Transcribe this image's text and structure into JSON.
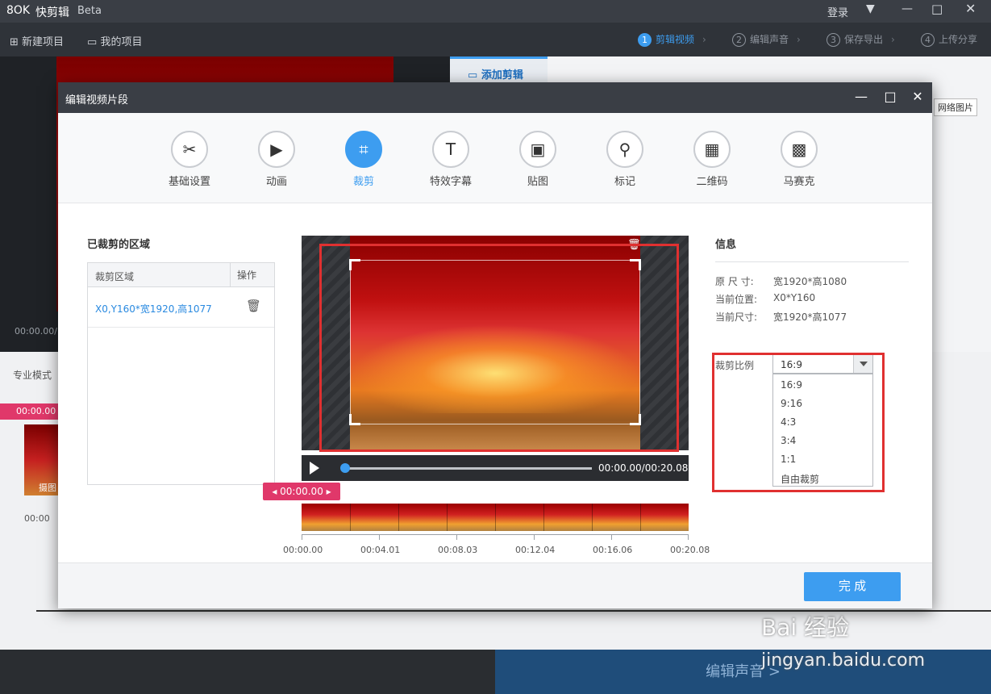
{
  "app": {
    "logo": "8OK",
    "name": "快剪辑",
    "beta": "Beta",
    "login": "登录"
  },
  "toolbar": {
    "new_project": "新建项目",
    "my_projects": "我的项目",
    "steps": [
      {
        "num": "1",
        "label": "剪辑视频"
      },
      {
        "num": "2",
        "label": "编辑声音"
      },
      {
        "num": "3",
        "label": "保存导出"
      },
      {
        "num": "4",
        "label": "上传分享"
      }
    ]
  },
  "background": {
    "add_clip_tab": "添加剪辑",
    "network_image": "网络图片",
    "time_partial": "00:00.00/",
    "pro_mode": "专业模式",
    "marker_time": "00:00.00",
    "clip_label": "摄图",
    "zero_time": "00:00",
    "next_step": "编辑声音 >",
    "watermark": "Bai 经验",
    "watermark_url": "jingyan.baidu.com"
  },
  "dialog": {
    "title": "编辑视频片段",
    "tabs": [
      {
        "label": "基础设置",
        "icon": "scissors-icon",
        "glyph": "✂"
      },
      {
        "label": "动画",
        "icon": "animation-icon",
        "glyph": "▶"
      },
      {
        "label": "裁剪",
        "icon": "crop-icon",
        "glyph": "⌗"
      },
      {
        "label": "特效字幕",
        "icon": "text-icon",
        "glyph": "T"
      },
      {
        "label": "贴图",
        "icon": "image-icon",
        "glyph": "▣"
      },
      {
        "label": "标记",
        "icon": "pin-icon",
        "glyph": "⚲"
      },
      {
        "label": "二维码",
        "icon": "qrcode-icon",
        "glyph": "▦"
      },
      {
        "label": "马赛克",
        "icon": "mosaic-icon",
        "glyph": "▩"
      }
    ],
    "cropped_title": "已裁剪的区域",
    "table_headers": {
      "region": "裁剪区域",
      "action": "操作"
    },
    "crop_rows": [
      {
        "region": "X0,Y160*宽1920,高1077"
      }
    ],
    "player": {
      "time": "00:00.00/00:20.08",
      "marker": "00:00.00",
      "progress": 0
    },
    "ruler_labels": [
      "00:00.00",
      "00:04.01",
      "00:08.03",
      "00:12.04",
      "00:16.06",
      "00:20.08"
    ],
    "info": {
      "title": "信息",
      "rows": [
        {
          "key": "原 尺 寸:",
          "value": "宽1920*高1080"
        },
        {
          "key": "当前位置:",
          "value": "X0*Y160"
        },
        {
          "key": "当前尺寸:",
          "value": "宽1920*高1077"
        }
      ],
      "ratio_label": "裁剪比例",
      "ratio_selected": "16:9",
      "ratio_options": [
        "16:9",
        "9:16",
        "4:3",
        "3:4",
        "1:1",
        "自由裁剪"
      ]
    },
    "done": "完 成"
  },
  "colors": {
    "accent": "#3d9df0",
    "highlight": "#e03030",
    "marker": "#e0386a"
  }
}
